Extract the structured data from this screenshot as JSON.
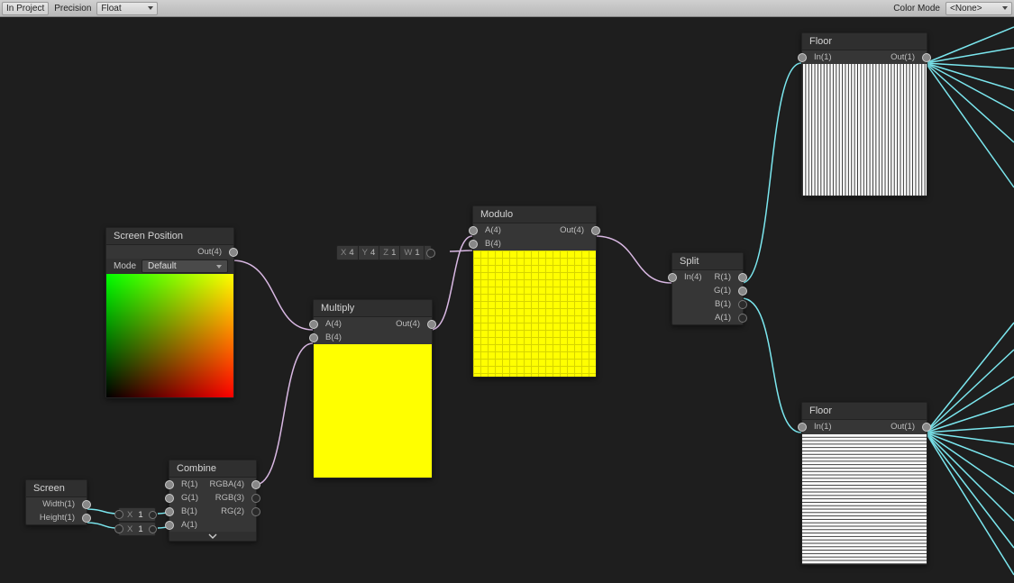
{
  "toolbar": {
    "show_in_project_label": "In Project",
    "precision_label": "Precision",
    "precision_value": "Float",
    "color_mode_label": "Color Mode",
    "color_mode_value": "<None>"
  },
  "nodes": {
    "screen_position": {
      "title": "Screen Position",
      "out": "Out(4)",
      "mode_label": "Mode",
      "mode_value": "Default"
    },
    "screen": {
      "title": "Screen",
      "width": "Width(1)",
      "height": "Height(1)"
    },
    "combine": {
      "title": "Combine",
      "r": "R(1)",
      "g": "G(1)",
      "b": "B(1)",
      "a": "A(1)",
      "rgba": "RGBA(4)",
      "rgb": "RGB(3)",
      "rg": "RG(2)"
    },
    "multiply": {
      "title": "Multiply",
      "a": "A(4)",
      "b": "B(4)",
      "out": "Out(4)"
    },
    "modulo": {
      "title": "Modulo",
      "a": "A(4)",
      "b": "B(4)",
      "out": "Out(4)"
    },
    "split": {
      "title": "Split",
      "in": "In(4)",
      "r": "R(1)",
      "g": "G(1)",
      "b": "B(1)",
      "a": "A(1)"
    },
    "floor1": {
      "title": "Floor",
      "in": "In(1)",
      "out": "Out(1)"
    },
    "floor2": {
      "title": "Floor",
      "in": "In(1)",
      "out": "Out(1)"
    }
  },
  "vector4": {
    "x_label": "X",
    "x": "4",
    "y_label": "Y",
    "y": "4",
    "z_label": "Z",
    "z": "1",
    "w_label": "W",
    "w": "1"
  },
  "floats": {
    "b_label": "X",
    "b_value": "1",
    "a_label": "X",
    "a_value": "1"
  }
}
